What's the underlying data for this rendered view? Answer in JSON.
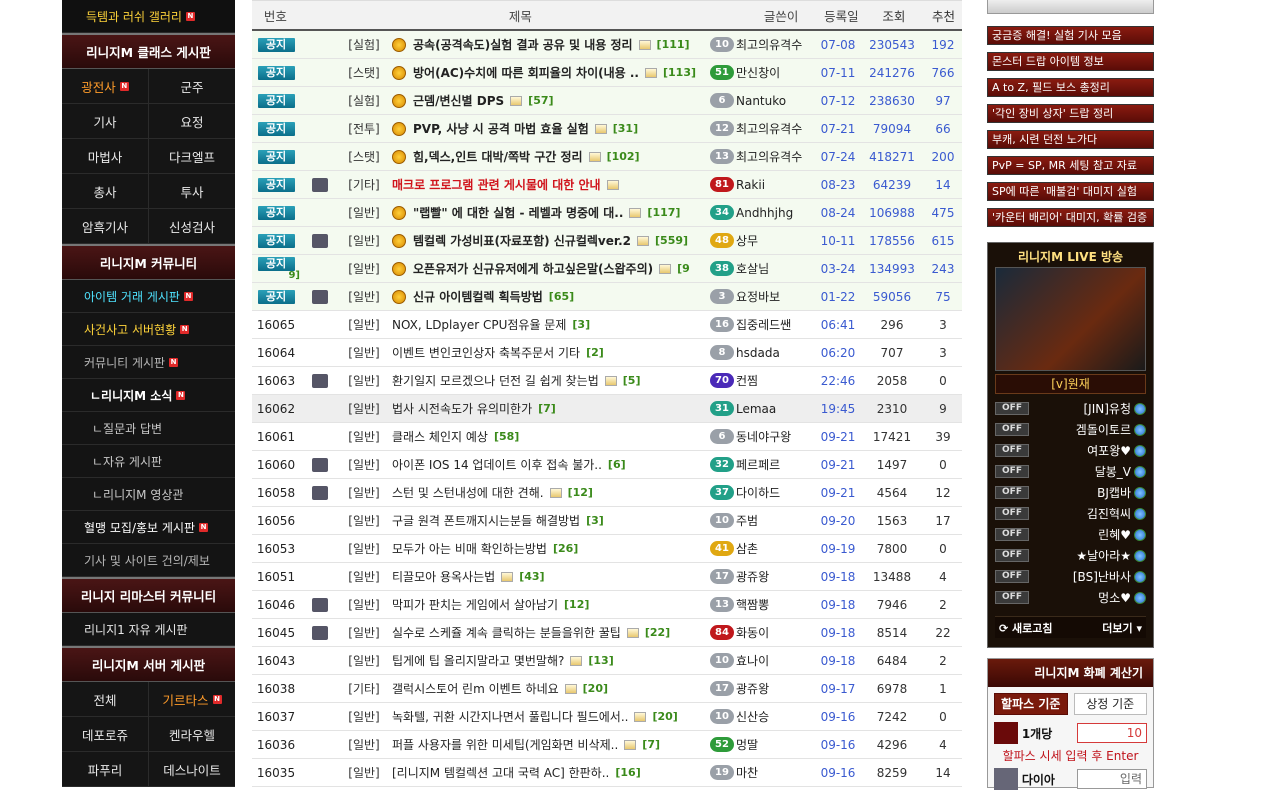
{
  "sidebar": {
    "top_link": "득템과 러쉬 갤러리",
    "class_board_title": "리니지M 클래스 게시판",
    "classes": [
      "광전사",
      "군주",
      "기사",
      "요정",
      "마법사",
      "다크엘프",
      "총사",
      "투사",
      "암흑기사",
      "신성검사"
    ],
    "community_title": "리니지M 커뮤니티",
    "community_items": [
      "아이템 거래 게시판",
      "사건사고 서버현황",
      "커뮤니티 게시판",
      "ㄴ리니지M 소식",
      "ㄴ질문과 답변",
      "ㄴ자유 게시판",
      "ㄴ리니지M 영상관",
      "혈맹 모집/홍보 게시판",
      "기사 및 사이트 건의/제보"
    ],
    "remaster_title": "리니지 리마스터 커뮤니티",
    "remaster_items": [
      "리니지1 자유 게시판"
    ],
    "server_title": "리니지M 서버 게시판",
    "servers": [
      "전체",
      "기르타스",
      "데포로쥬",
      "켄라우헬",
      "파푸리",
      "데스나이트"
    ]
  },
  "board": {
    "headers": [
      "번호",
      "제목",
      "글쓴이",
      "등록일",
      "조회",
      "추천"
    ],
    "notice_label": "공지",
    "rows": [
      {
        "no": "",
        "cat": "[실험]",
        "title": "공속(공격속도)실험 결과 공유 및 내용 정리",
        "cmt": "[111]",
        "lv": "10",
        "author": "최고의유격수",
        "date": "07-08",
        "views": "230543",
        "rec": "192",
        "notice": true,
        "medal": true,
        "img": true,
        "bold": true
      },
      {
        "no": "",
        "cat": "[스탯]",
        "title": "방어(AC)수치에 따른 회피율의 차이(내용 ..",
        "cmt": "[113]",
        "lv": "51",
        "author": "만신창이",
        "date": "07-11",
        "views": "241276",
        "rec": "766",
        "notice": true,
        "medal": true,
        "img": true,
        "bold": true
      },
      {
        "no": "",
        "cat": "[실험]",
        "title": "근뎀/변신별 DPS",
        "cmt": "[57]",
        "lv": "6",
        "author": "Nantuko",
        "date": "07-12",
        "views": "238630",
        "rec": "97",
        "notice": true,
        "medal": true,
        "img": true,
        "bold": true
      },
      {
        "no": "",
        "cat": "[전투]",
        "title": "PVP, 사냥 시 공격 마법 효율 실험",
        "cmt": "[31]",
        "lv": "12",
        "author": "최고의유격수",
        "date": "07-21",
        "views": "79094",
        "rec": "66",
        "notice": true,
        "medal": true,
        "img": true,
        "bold": true
      },
      {
        "no": "",
        "cat": "[스탯]",
        "title": "힘,덱스,인트 대박/쪽박 구간 정리",
        "cmt": "[102]",
        "lv": "13",
        "author": "최고의유격수",
        "date": "07-24",
        "views": "418271",
        "rec": "200",
        "notice": true,
        "medal": true,
        "img": true,
        "bold": true
      },
      {
        "no": "",
        "cat": "[기타]",
        "title": "매크로 프로그램 관련 게시물에 대한 안내",
        "cmt": "",
        "lv": "81",
        "author": "Rakii",
        "date": "08-23",
        "views": "64239",
        "rec": "14",
        "notice": true,
        "medal": false,
        "img": true,
        "red": true,
        "icon": true
      },
      {
        "no": "",
        "cat": "[일반]",
        "title": "\"랩빨\" 에 대한 실험 - 레벨과 명중에 대..",
        "cmt": "[117]",
        "lv": "34",
        "author": "Andhhjhg",
        "date": "08-24",
        "views": "106988",
        "rec": "475",
        "notice": true,
        "medal": true,
        "img": true,
        "bold": true
      },
      {
        "no": "",
        "cat": "[일반]",
        "title": "템컬렉 가성비표(자료포함) 신규컬렉ver.2",
        "cmt": "[559]",
        "lv": "48",
        "author": "상무",
        "date": "10-11",
        "views": "178556",
        "rec": "615",
        "notice": true,
        "medal": true,
        "img": true,
        "bold": true,
        "icon": true
      },
      {
        "no": "",
        "cat": "[일반]",
        "title": "오픈유저가 신규유저에게 하고싶은말(스왑주의)",
        "cmt": "[9",
        "lv": "38",
        "author": "호살님",
        "date": "03-24",
        "views": "134993",
        "rec": "243",
        "notice": true,
        "medal": true,
        "img": true,
        "bold": true,
        "wrap": "9]"
      },
      {
        "no": "",
        "cat": "[일반]",
        "title": "신규 아이템컬렉 획득방법",
        "cmt": "[65]",
        "lv": "3",
        "author": "요정바보",
        "date": "01-22",
        "views": "59056",
        "rec": "75",
        "notice": true,
        "medal": true,
        "img": false,
        "bold": true,
        "icon": true
      },
      {
        "no": "16065",
        "cat": "[일반]",
        "title": "NOX, LDplayer CPU점유율 문제",
        "cmt": "[3]",
        "lv": "16",
        "author": "집중레드쌘",
        "date": "06:41",
        "views": "296",
        "rec": "3"
      },
      {
        "no": "16064",
        "cat": "[일반]",
        "title": "이벤트 변인코인상자 축복주문서 기타",
        "cmt": "[2]",
        "lv": "8",
        "author": "hsdada",
        "date": "06:20",
        "views": "707",
        "rec": "3"
      },
      {
        "no": "16063",
        "cat": "[일반]",
        "title": "환기일지 모르겠으나 던전 길 쉽게 찾는법",
        "cmt": "[5]",
        "lv": "70",
        "author": "컨찜",
        "date": "22:46",
        "views": "2058",
        "rec": "0",
        "img": true,
        "icon": true
      },
      {
        "no": "16062",
        "cat": "[일반]",
        "title": "법사 시전속도가 유의미한가",
        "cmt": "[7]",
        "lv": "31",
        "author": "Lemaa",
        "date": "19:45",
        "views": "2310",
        "rec": "9",
        "hl": true
      },
      {
        "no": "16061",
        "cat": "[일반]",
        "title": "클래스 체인지 예상",
        "cmt": "[58]",
        "lv": "6",
        "author": "동네야구왕",
        "date": "09-21",
        "views": "17421",
        "rec": "39"
      },
      {
        "no": "16060",
        "cat": "[일반]",
        "title": "아이폰 IOS 14 업데이트 이후 접속 불가..",
        "cmt": "[6]",
        "lv": "32",
        "author": "페르페르",
        "date": "09-21",
        "views": "1497",
        "rec": "0",
        "icon": true
      },
      {
        "no": "16058",
        "cat": "[일반]",
        "title": "스턴 및 스턴내성에 대한 견해.",
        "cmt": "[12]",
        "lv": "37",
        "author": "다이하드",
        "date": "09-21",
        "views": "4564",
        "rec": "12",
        "img": true,
        "icon": true
      },
      {
        "no": "16056",
        "cat": "[일반]",
        "title": "구글 원격 폰트깨지시는분들 해결방법",
        "cmt": "[3]",
        "lv": "10",
        "author": "주범",
        "date": "09-20",
        "views": "1563",
        "rec": "17"
      },
      {
        "no": "16053",
        "cat": "[일반]",
        "title": "모두가 아는 비매 확인하는방법",
        "cmt": "[26]",
        "lv": "41",
        "author": "삼촌",
        "date": "09-19",
        "views": "7800",
        "rec": "0"
      },
      {
        "no": "16051",
        "cat": "[일반]",
        "title": "티끌모아 용옥사는법",
        "cmt": "[43]",
        "lv": "17",
        "author": "광쥬왕",
        "date": "09-18",
        "views": "13488",
        "rec": "4",
        "img": true
      },
      {
        "no": "16046",
        "cat": "[일반]",
        "title": "막피가 판치는 게임에서 살아남기",
        "cmt": "[12]",
        "lv": "13",
        "author": "핵짬뽕",
        "date": "09-18",
        "views": "7946",
        "rec": "2",
        "icon": true
      },
      {
        "no": "16045",
        "cat": "[일반]",
        "title": "실수로 스케쥴 계속 클릭하는 분들을위한 꿀팁",
        "cmt": "[22]",
        "lv": "84",
        "author": "화동이",
        "date": "09-18",
        "views": "8514",
        "rec": "22",
        "img": true,
        "icon": true
      },
      {
        "no": "16043",
        "cat": "[일반]",
        "title": "팁게에 팁 올리지말라고 몇번말해?",
        "cmt": "[13]",
        "lv": "10",
        "author": "효나이",
        "date": "09-18",
        "views": "6484",
        "rec": "2",
        "img": true
      },
      {
        "no": "16038",
        "cat": "[기타]",
        "title": "갤럭시스토어 린m 이벤트 하네요",
        "cmt": "[20]",
        "lv": "17",
        "author": "광쥬왕",
        "date": "09-17",
        "views": "6978",
        "rec": "1",
        "img": true
      },
      {
        "no": "16037",
        "cat": "[일반]",
        "title": "녹화텔, 귀환 시간지나면서 풀립니다 필드에서..",
        "cmt": "[20]",
        "lv": "10",
        "author": "신산승",
        "date": "09-16",
        "views": "7242",
        "rec": "0",
        "img": true
      },
      {
        "no": "16036",
        "cat": "[일반]",
        "title": "퍼플 사용자를 위한 미세팁(게임화면 비삭제..",
        "cmt": "[7]",
        "lv": "52",
        "author": "멍딸",
        "date": "09-16",
        "views": "4296",
        "rec": "4",
        "img": true
      },
      {
        "no": "16035",
        "cat": "[일반]",
        "title": "[리니지M 템컬렉션 고대 국력 AC] 한판하..",
        "cmt": "[16]",
        "lv": "19",
        "author": "마찬",
        "date": "09-16",
        "views": "8259",
        "rec": "14"
      }
    ]
  },
  "right": {
    "tips": [
      "궁금증 해결! 실험 기사 모음",
      "몬스터 드랍 아이템 정보",
      "A to Z, 필드 보스 총정리",
      "'각인 장비 상자' 드랍 정리",
      "부캐, 시련 던전 노가다",
      "PvP = SP, MR 세팅 참고 자료",
      "SP에 따른 '매불검' 대미지 실험",
      "'카운터 배리어' 대미지, 확률 검증"
    ],
    "live": {
      "title": "리니지M LIVE 방송",
      "caption": "[v]원재",
      "off_label": "OFF",
      "channels": [
        "[JIN]유청",
        "겜돌이토르",
        "여포왕♥",
        "달봉_V",
        "BJ캡바",
        "김진혁씨",
        "린혜♥",
        "★날아라★",
        "[BS]난바사",
        "멍소♥"
      ],
      "refresh": "새로고침",
      "more": "더보기"
    },
    "calc": {
      "title": "리니지M 화폐 계산기",
      "tab_active": "할파스 기준",
      "tab_other": "상정 기준",
      "unit_label": "1개당",
      "unit_value": "10",
      "note": "할파스 시세 입력 후 Enter",
      "dia_label": "다이아",
      "dia_placeholder": "입력"
    }
  }
}
